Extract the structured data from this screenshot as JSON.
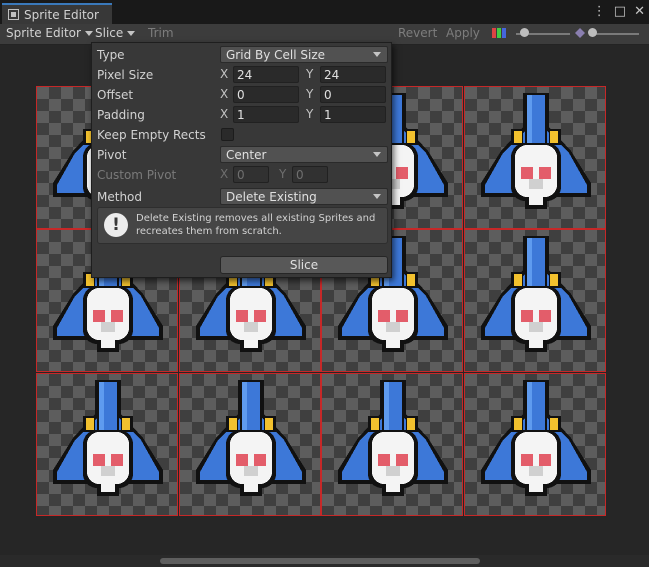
{
  "window": {
    "title": "Sprite Editor"
  },
  "toolbar": {
    "sprite_editor_label": "Sprite Editor",
    "slice_label": "Slice",
    "trim_label": "Trim",
    "revert_label": "Revert",
    "apply_label": "Apply"
  },
  "slice_popup": {
    "type": {
      "label": "Type",
      "value": "Grid By Cell Size"
    },
    "pixel_size": {
      "label": "Pixel Size",
      "x_label": "X",
      "x": "24",
      "y_label": "Y",
      "y": "24"
    },
    "offset": {
      "label": "Offset",
      "x_label": "X",
      "x": "0",
      "y_label": "Y",
      "y": "0"
    },
    "padding": {
      "label": "Padding",
      "x_label": "X",
      "x": "1",
      "y_label": "Y",
      "y": "1"
    },
    "keep_empty": {
      "label": "Keep Empty Rects",
      "checked": false
    },
    "pivot": {
      "label": "Pivot",
      "value": "Center"
    },
    "custom_pivot": {
      "label": "Custom Pivot",
      "x_label": "X",
      "x": "0",
      "y_label": "Y",
      "y": "0"
    },
    "method": {
      "label": "Method",
      "value": "Delete Existing"
    },
    "help_text": "Delete Existing removes all existing Sprites and recreates them from scratch.",
    "slice_button": "Slice"
  },
  "colors": {
    "accent": "#3a79bb",
    "cell_border": "#c62828",
    "ship_blue": "#3d78d8",
    "ship_yellow": "#f2c12e",
    "ship_pink": "#e35d6a"
  }
}
